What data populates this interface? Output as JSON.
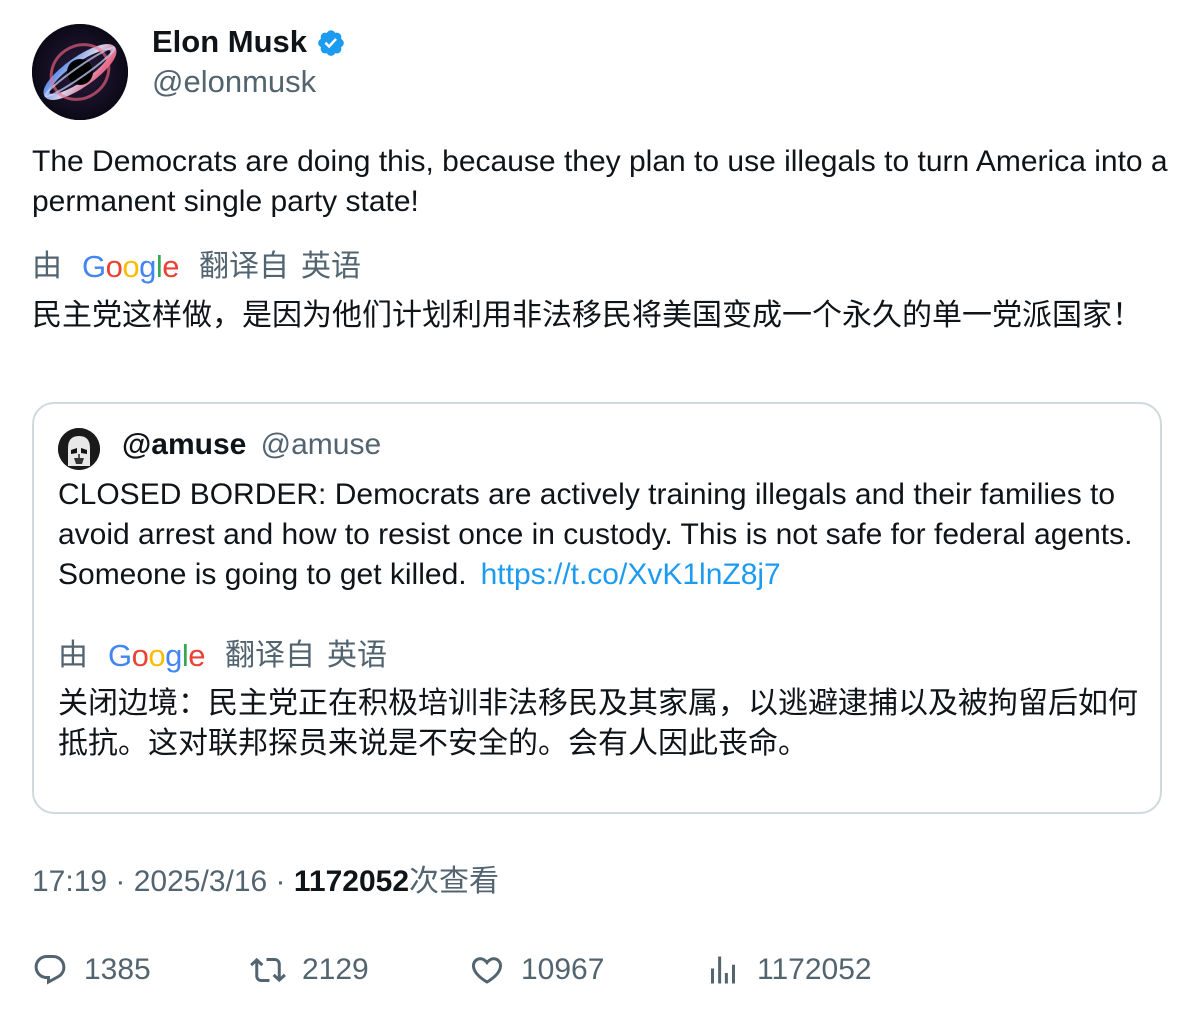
{
  "author": {
    "display_name": "Elon Musk",
    "handle": "@elonmusk",
    "verified": true,
    "avatar_icon": "black-hole-avatar"
  },
  "tweet": {
    "text": "The Democrats are doing this, because they plan to use illegals to turn America into a permanent single party state!",
    "translation_label_prefix": "由",
    "translation_provider": "Google",
    "translation_label_suffix": "翻译自",
    "translation_source_lang": "英语",
    "translated_text": "民主党这样做，是因为他们计划利用非法移民将美国变成一个永久的单一党派国家！"
  },
  "quote": {
    "display_name": "@amuse",
    "handle": "@amuse",
    "avatar_icon": "stormtrooper-avatar",
    "text": "CLOSED BORDER: Democrats are actively training illegals and their families to avoid arrest and how to resist once in custody. This is not safe for federal agents. Someone is going to get killed.",
    "link": "https://t.co/XvK1lnZ8j7",
    "translation_label_prefix": "由",
    "translation_provider": "Google",
    "translation_label_suffix": "翻译自",
    "translation_source_lang": "英语",
    "translated_text": "关闭边境：民主党正在积极培训非法移民及其家属，以逃避逮捕以及被拘留后如何抵抗。这对联邦探员来说是不安全的。会有人因此丧命。"
  },
  "meta": {
    "time": "17:19",
    "separator": " · ",
    "date": "2025/3/16",
    "views_count": "1172052",
    "views_label": "次查看"
  },
  "actions": {
    "replies": "1385",
    "reposts": "2129",
    "likes": "10967",
    "views": "1172052"
  },
  "colors": {
    "link": "#1d9bf0",
    "secondary_text": "#536471",
    "primary_text": "#0f1419",
    "border": "#cfd9de",
    "verified": "#1d9bf0"
  }
}
